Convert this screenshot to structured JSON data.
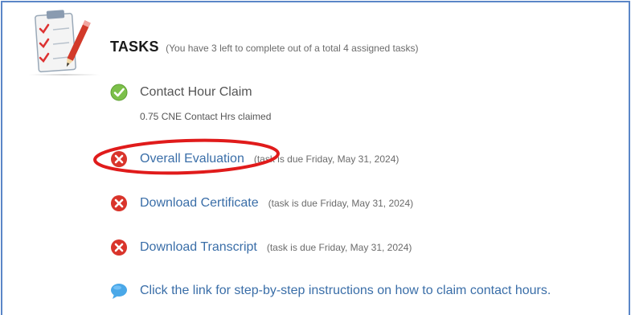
{
  "tasks": {
    "heading": "TASKS",
    "summary": "(You have 3 left to complete out of a total 4 assigned tasks)",
    "icon": "clipboard-checklist-icon",
    "items": [
      {
        "label": "Contact Hour Claim",
        "status": "complete",
        "icon": "check-icon",
        "detail": "0.75 CNE Contact Hrs claimed"
      },
      {
        "label": "Overall Evaluation",
        "status": "incomplete",
        "icon": "x-icon",
        "due": "(task is due Friday, May 31, 2024)"
      },
      {
        "label": "Download Certificate",
        "status": "incomplete",
        "icon": "x-icon",
        "due": "(task is due Friday, May 31, 2024)"
      },
      {
        "label": "Download Transcript",
        "status": "incomplete",
        "icon": "x-icon",
        "due": "(task is due Friday, May 31, 2024)"
      }
    ],
    "instructions": {
      "label": "Click the link for step-by-step instructions on how to claim contact hours.",
      "icon": "speech-bubble-icon"
    }
  },
  "colors": {
    "frame": "#5b86c7",
    "link": "#3a6ea8",
    "complete": "#7cc04a",
    "incomplete": "#d9342b",
    "highlight_circle": "#e01b1b",
    "bubble": "#4aa8e8"
  }
}
